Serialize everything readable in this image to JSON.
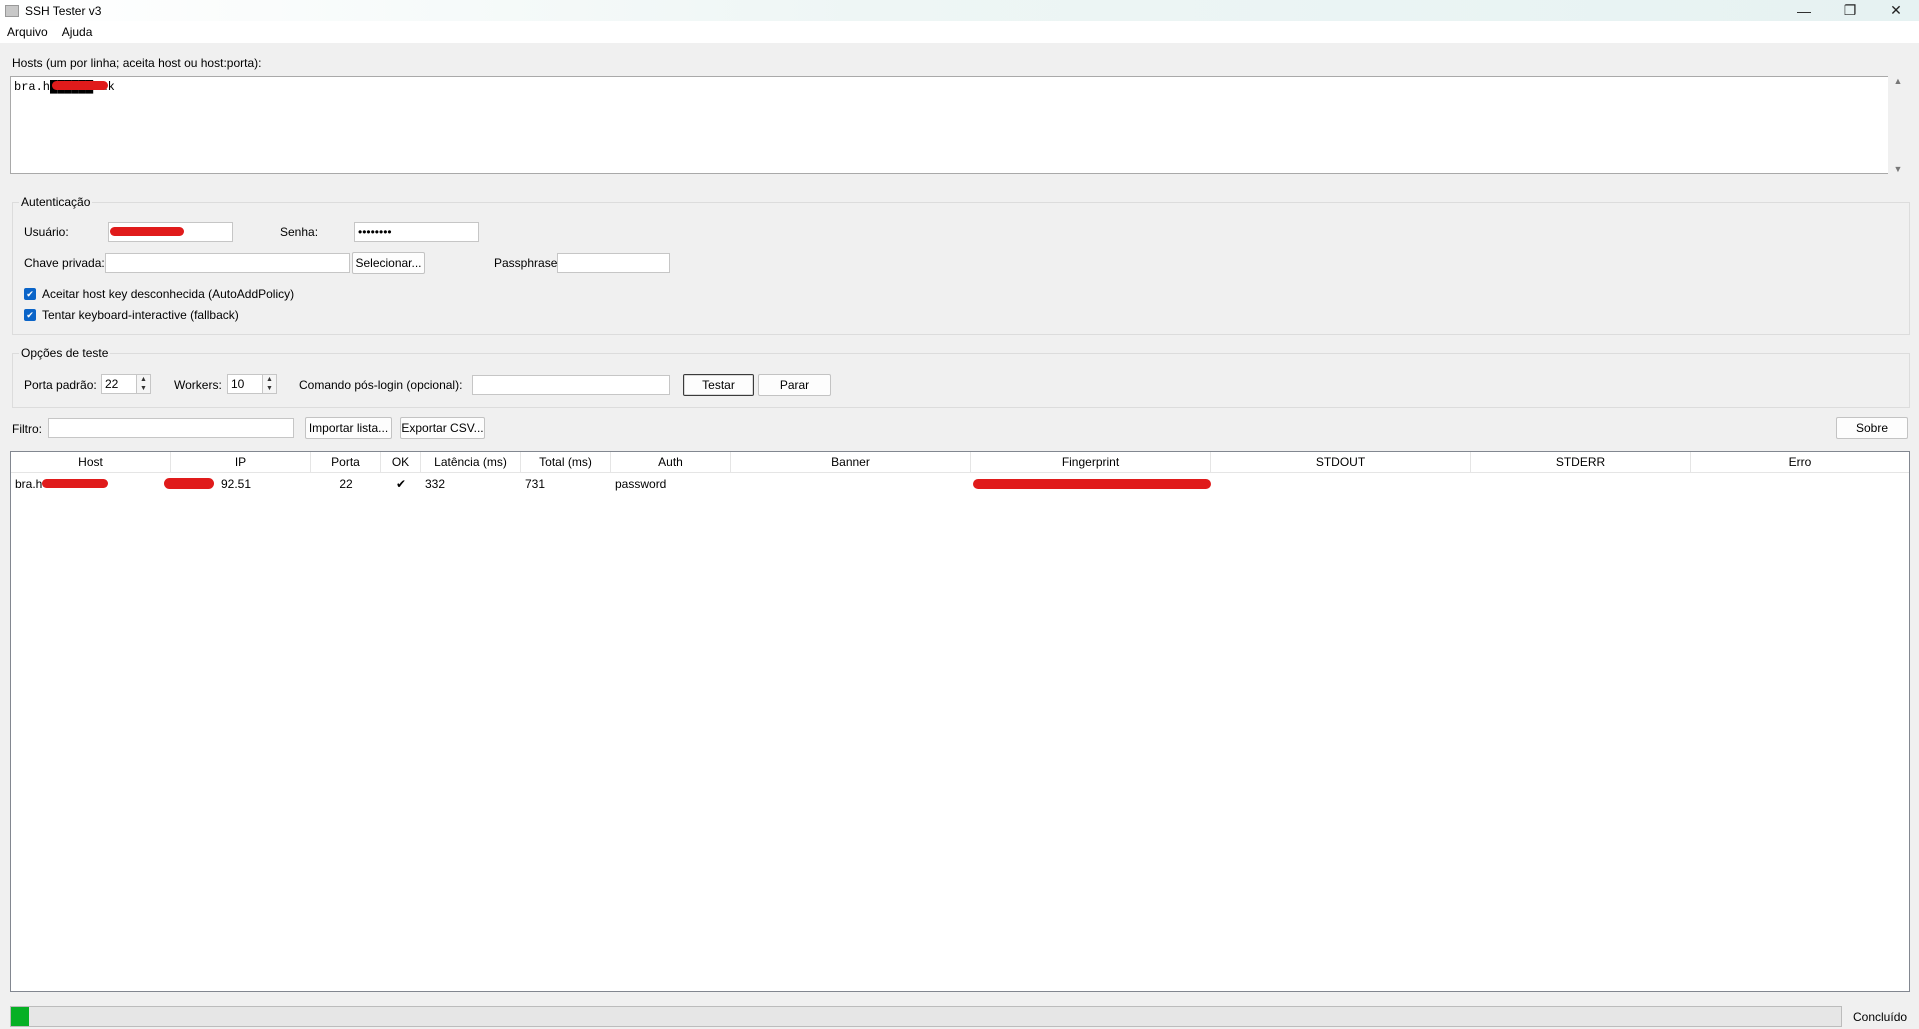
{
  "window": {
    "title": "SSH Tester v3",
    "minimize": "—",
    "maximize": "❐",
    "close": "✕"
  },
  "menu": [
    "Arquivo",
    "Ajuda"
  ],
  "hosts": {
    "label": "Hosts (um por linha; aceita host ou host:porta):",
    "value": "bra.h██████.uk"
  },
  "auth": {
    "title": "Autenticação",
    "user_label": "Usuário:",
    "user_value": "",
    "password_label": "Senha:",
    "password_value": "••••••••",
    "key_label": "Chave privada:",
    "key_value": "",
    "select_button": "Selecionar...",
    "passphrase_label": "Passphrase:",
    "passphrase_value": "",
    "accept_hostkey": "Aceitar host key desconhecida (AutoAddPolicy)",
    "keyboard_interactive": "Tentar keyboard-interactive (fallback)"
  },
  "options": {
    "title": "Opções de teste",
    "port_label": "Porta padrão:",
    "port_value": "22",
    "workers_label": "Workers:",
    "workers_value": "10",
    "command_label": "Comando pós-login (opcional):",
    "command_value": "",
    "test_button": "Testar",
    "stop_button": "Parar"
  },
  "filter": {
    "label": "Filtro:",
    "value": "",
    "import_button": "Importar lista...",
    "export_button": "Exportar CSV...",
    "about_button": "Sobre"
  },
  "table": {
    "columns": [
      "Host",
      "IP",
      "Porta",
      "OK",
      "Latência (ms)",
      "Total (ms)",
      "Auth",
      "Banner",
      "Fingerprint",
      "STDOUT",
      "STDERR",
      "Erro"
    ],
    "rows": [
      {
        "host": "bra.h",
        "ip": "92.51",
        "port": "22",
        "ok": "✔",
        "latency": "332",
        "total": "731",
        "auth": "password",
        "banner": "",
        "fingerprint": "",
        "stdout": "",
        "stderr": "",
        "error": ""
      }
    ]
  },
  "status": {
    "progress_fraction": 0.01,
    "text": "Concluído"
  },
  "colors": {
    "progress": "#06b025",
    "checkbox": "#0a64c8",
    "redaction": "#e01b1b"
  }
}
